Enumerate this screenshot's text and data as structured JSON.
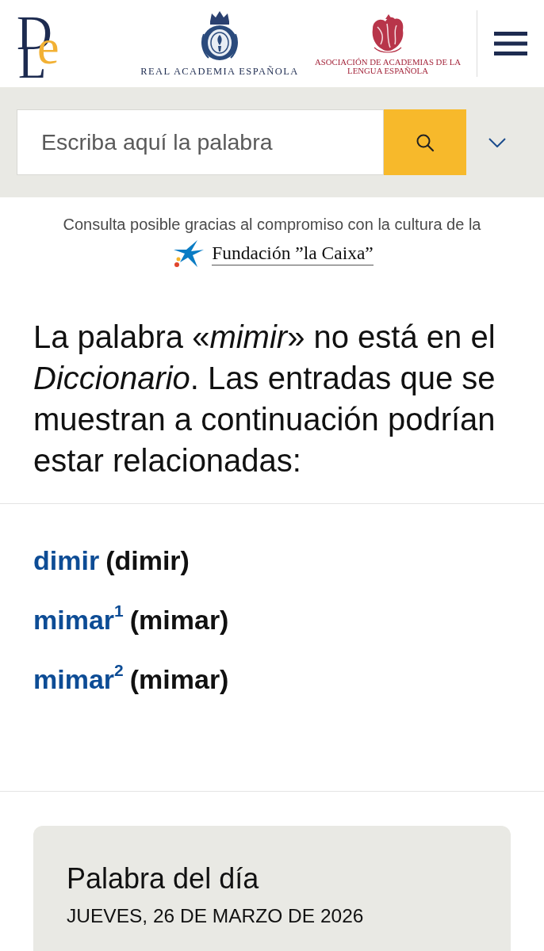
{
  "header": {
    "logo": {
      "letters": [
        "D",
        "L",
        "e"
      ]
    },
    "academy": {
      "name": "REAL ACADEMIA ESPAÑOLA"
    },
    "association": {
      "name_lines": [
        "ASOCIACIÓN DE ACADEMIAS DE LA",
        "LENGUA ESPAÑOLA"
      ]
    }
  },
  "search": {
    "placeholder": "Escriba aquí la palabra"
  },
  "sponsor": {
    "text": "Consulta posible gracias al compromiso con la cultura de la",
    "name": "Fundación ”la Caixa”"
  },
  "message": "La palabra «*mimir*» no está en el *Diccionario*. Las entradas que se muestran a continuación podrían estar relacionadas:",
  "entries": [
    {
      "word": "dimir",
      "lemma": "(dimir)"
    },
    {
      "word": "mimar$^{1}$",
      "lemma": "(mimar)"
    },
    {
      "word": "mimar$^{2}$",
      "lemma": "(mimar)"
    }
  ],
  "word_of_day": {
    "title": "Palabra del día",
    "date": "JUEVES, 26 DE MARZO DE 2026"
  }
}
